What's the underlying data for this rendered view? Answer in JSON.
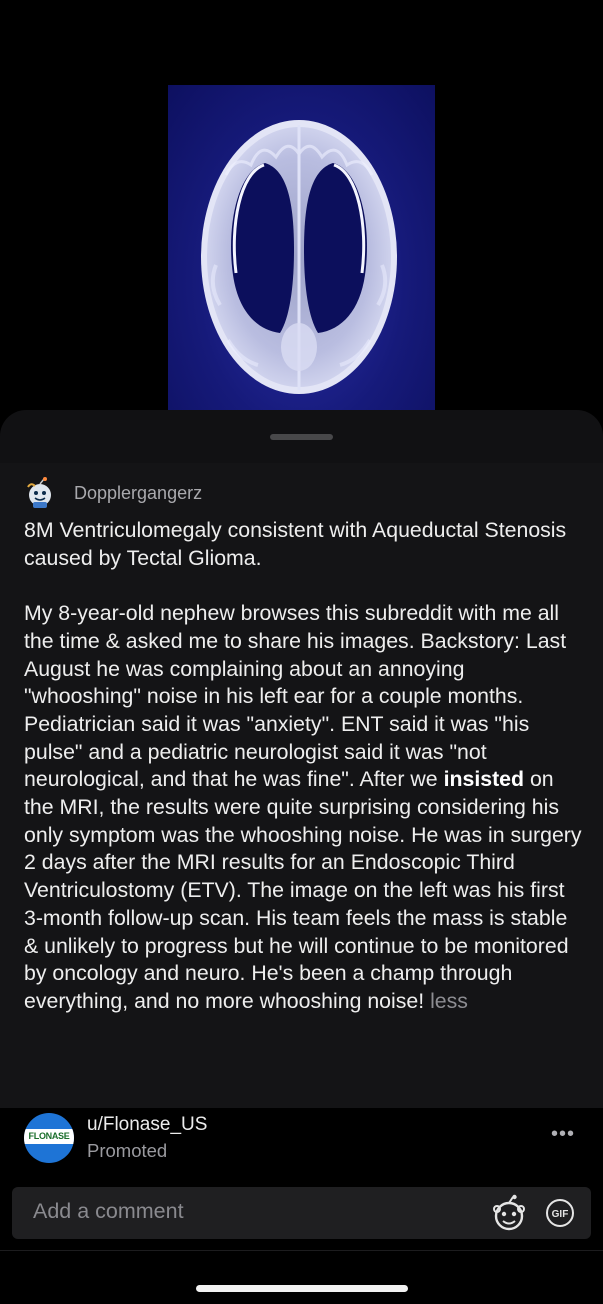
{
  "media": {
    "alt_icon": "brain-mri-image"
  },
  "post": {
    "author": "Dopplergangerz",
    "avatar_icon": "snoo-avatar-icon",
    "title": "8M Ventriculomegaly consistent with Aqueductal Stenosis caused by Tectal Glioma.",
    "body_before_bold": "My 8-year-old nephew browses this subreddit with me all the time & asked me to share his images. Backstory: Last August he was complaining about an annoying \"whooshing\" noise in his left ear for a couple months. Pediatrician said it was \"anxiety\". ENT said it was \"his pulse\" and a pediatric neurologist said it was \"not neurological, and that he was fine\". After we ",
    "body_bold": "insisted",
    "body_after_bold": " on the MRI, the results were quite surprising considering his only symptom was the whooshing noise. He was in surgery 2 days after the MRI results for an Endoscopic Third Ventriculostomy (ETV). The image on the left was his first 3-month follow-up scan. His team feels the mass is stable & unlikely to progress but he will continue to be monitored by oncology and neuro. He's been a champ through everything, and no more whooshing noise! ",
    "less_label": "less"
  },
  "promo": {
    "username": "u/Flonase_US",
    "label": "Promoted",
    "logo_text": "FLONASE",
    "more_label": "•••"
  },
  "comment": {
    "placeholder": "Add a comment",
    "gif_label": "GIF"
  },
  "colors": {
    "background": "#000000",
    "sheet": "#141416",
    "text": "#eeeeee",
    "muted": "#8d8d92"
  }
}
